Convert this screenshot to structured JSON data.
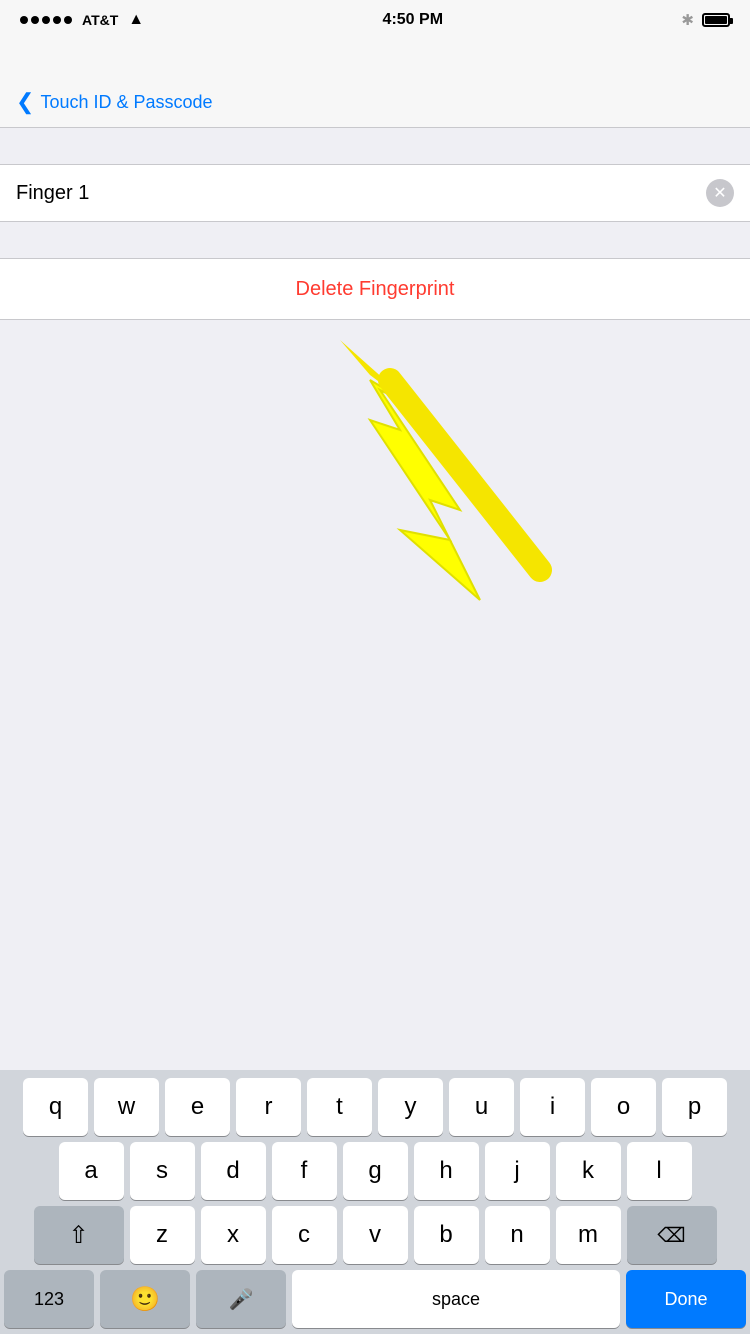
{
  "statusBar": {
    "carrier": "AT&T",
    "time": "4:50 PM",
    "bluetooth": "✦"
  },
  "navBar": {
    "backLabel": "Touch ID & Passcode",
    "backChevron": "‹"
  },
  "inputField": {
    "value": "Finger 1",
    "placeholder": "Finger 1"
  },
  "deleteButton": {
    "label": "Delete Fingerprint"
  },
  "keyboard": {
    "row1": [
      "q",
      "w",
      "e",
      "r",
      "t",
      "y",
      "u",
      "i",
      "o",
      "p"
    ],
    "row2": [
      "a",
      "s",
      "d",
      "f",
      "g",
      "h",
      "j",
      "k",
      "l"
    ],
    "row3": [
      "z",
      "x",
      "c",
      "v",
      "b",
      "n",
      "m"
    ],
    "spaceLabel": "space",
    "doneLabel": "Done",
    "numberLabel": "123"
  }
}
